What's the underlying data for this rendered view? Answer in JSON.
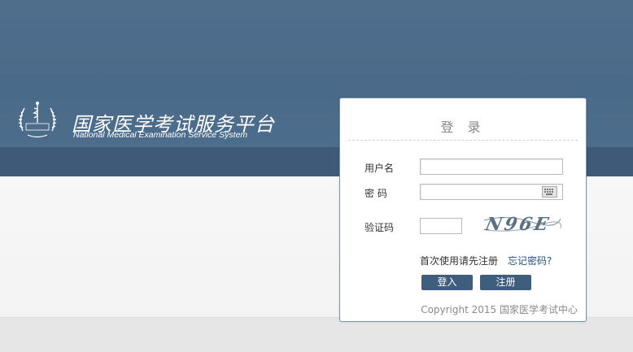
{
  "header": {
    "title_cn": "国家医学考试服务平台",
    "title_en": "National Medical Examination Service System"
  },
  "login": {
    "title": "登 录",
    "username_label": "用户名",
    "username_value": "",
    "password_label": "密 码",
    "password_value": "",
    "captcha_label": "验证码",
    "captcha_value": "",
    "captcha_image_text": "N96E",
    "first_use_link": "首次使用请先注册",
    "forgot_link": "忘记密码?",
    "login_button": "登入",
    "register_button": "注册",
    "copyright": "Copyright 2015 国家医学考试中心"
  },
  "icons": {
    "emblem": "medical-emblem-icon",
    "keyboard": "keyboard-icon"
  },
  "colors": {
    "header_bg": "#4a6a89",
    "band_dark": "#3e5a78",
    "button_bg": "#3f5d7c",
    "link": "#23527c"
  }
}
